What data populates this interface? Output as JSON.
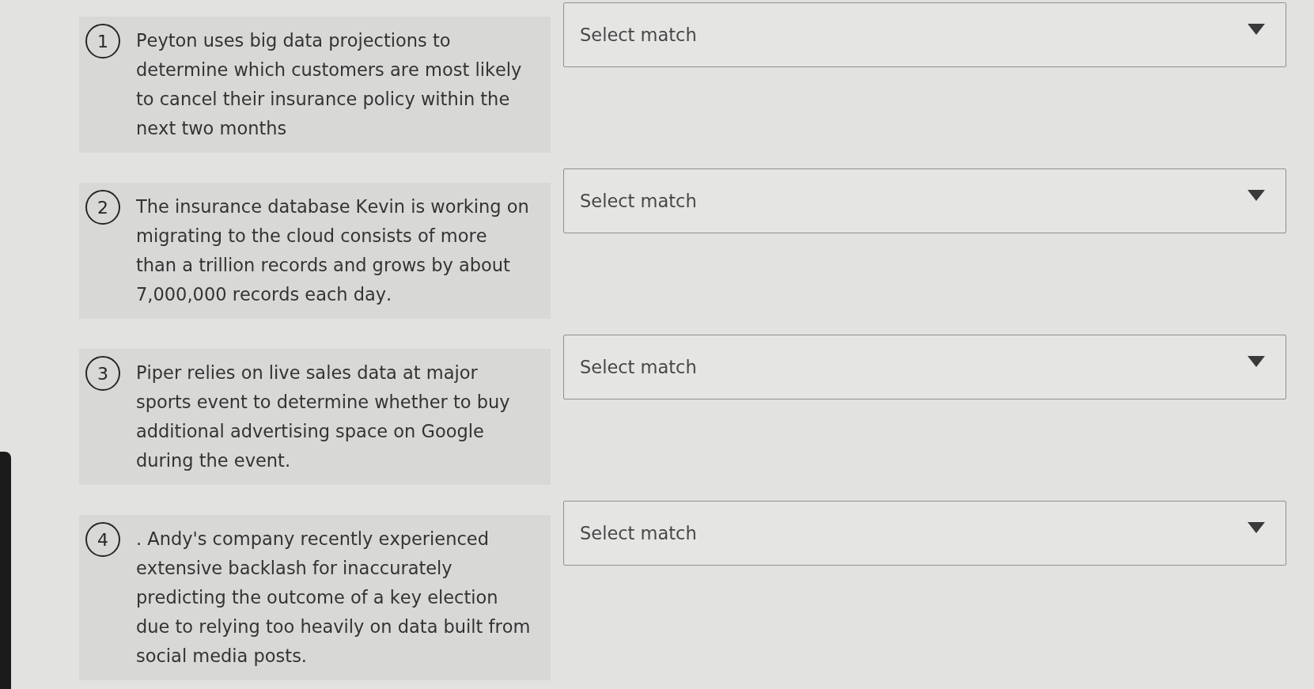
{
  "prompts": [
    {
      "number": "1",
      "text": "Peyton uses big data projections to determine which customers are most likely to cancel their insurance policy within the next two months",
      "match": {
        "placeholder": "Select match"
      }
    },
    {
      "number": "2",
      "text": "The insurance database Kevin is working on migrating to the cloud consists of more than a trillion records and grows by about 7,000,000 records each day.",
      "match": {
        "placeholder": "Select match"
      }
    },
    {
      "number": "3",
      "text": "Piper relies on live sales data at major sports event to determine whether to buy additional advertising space on Google during the event.",
      "match": {
        "placeholder": "Select match"
      }
    },
    {
      "number": "4",
      "text": ". Andy's company recently experienced extensive backlash for inaccurately predicting the outcome of a key election due to relying too heavily on data built from social media posts.",
      "match": {
        "placeholder": "Select match"
      }
    }
  ]
}
